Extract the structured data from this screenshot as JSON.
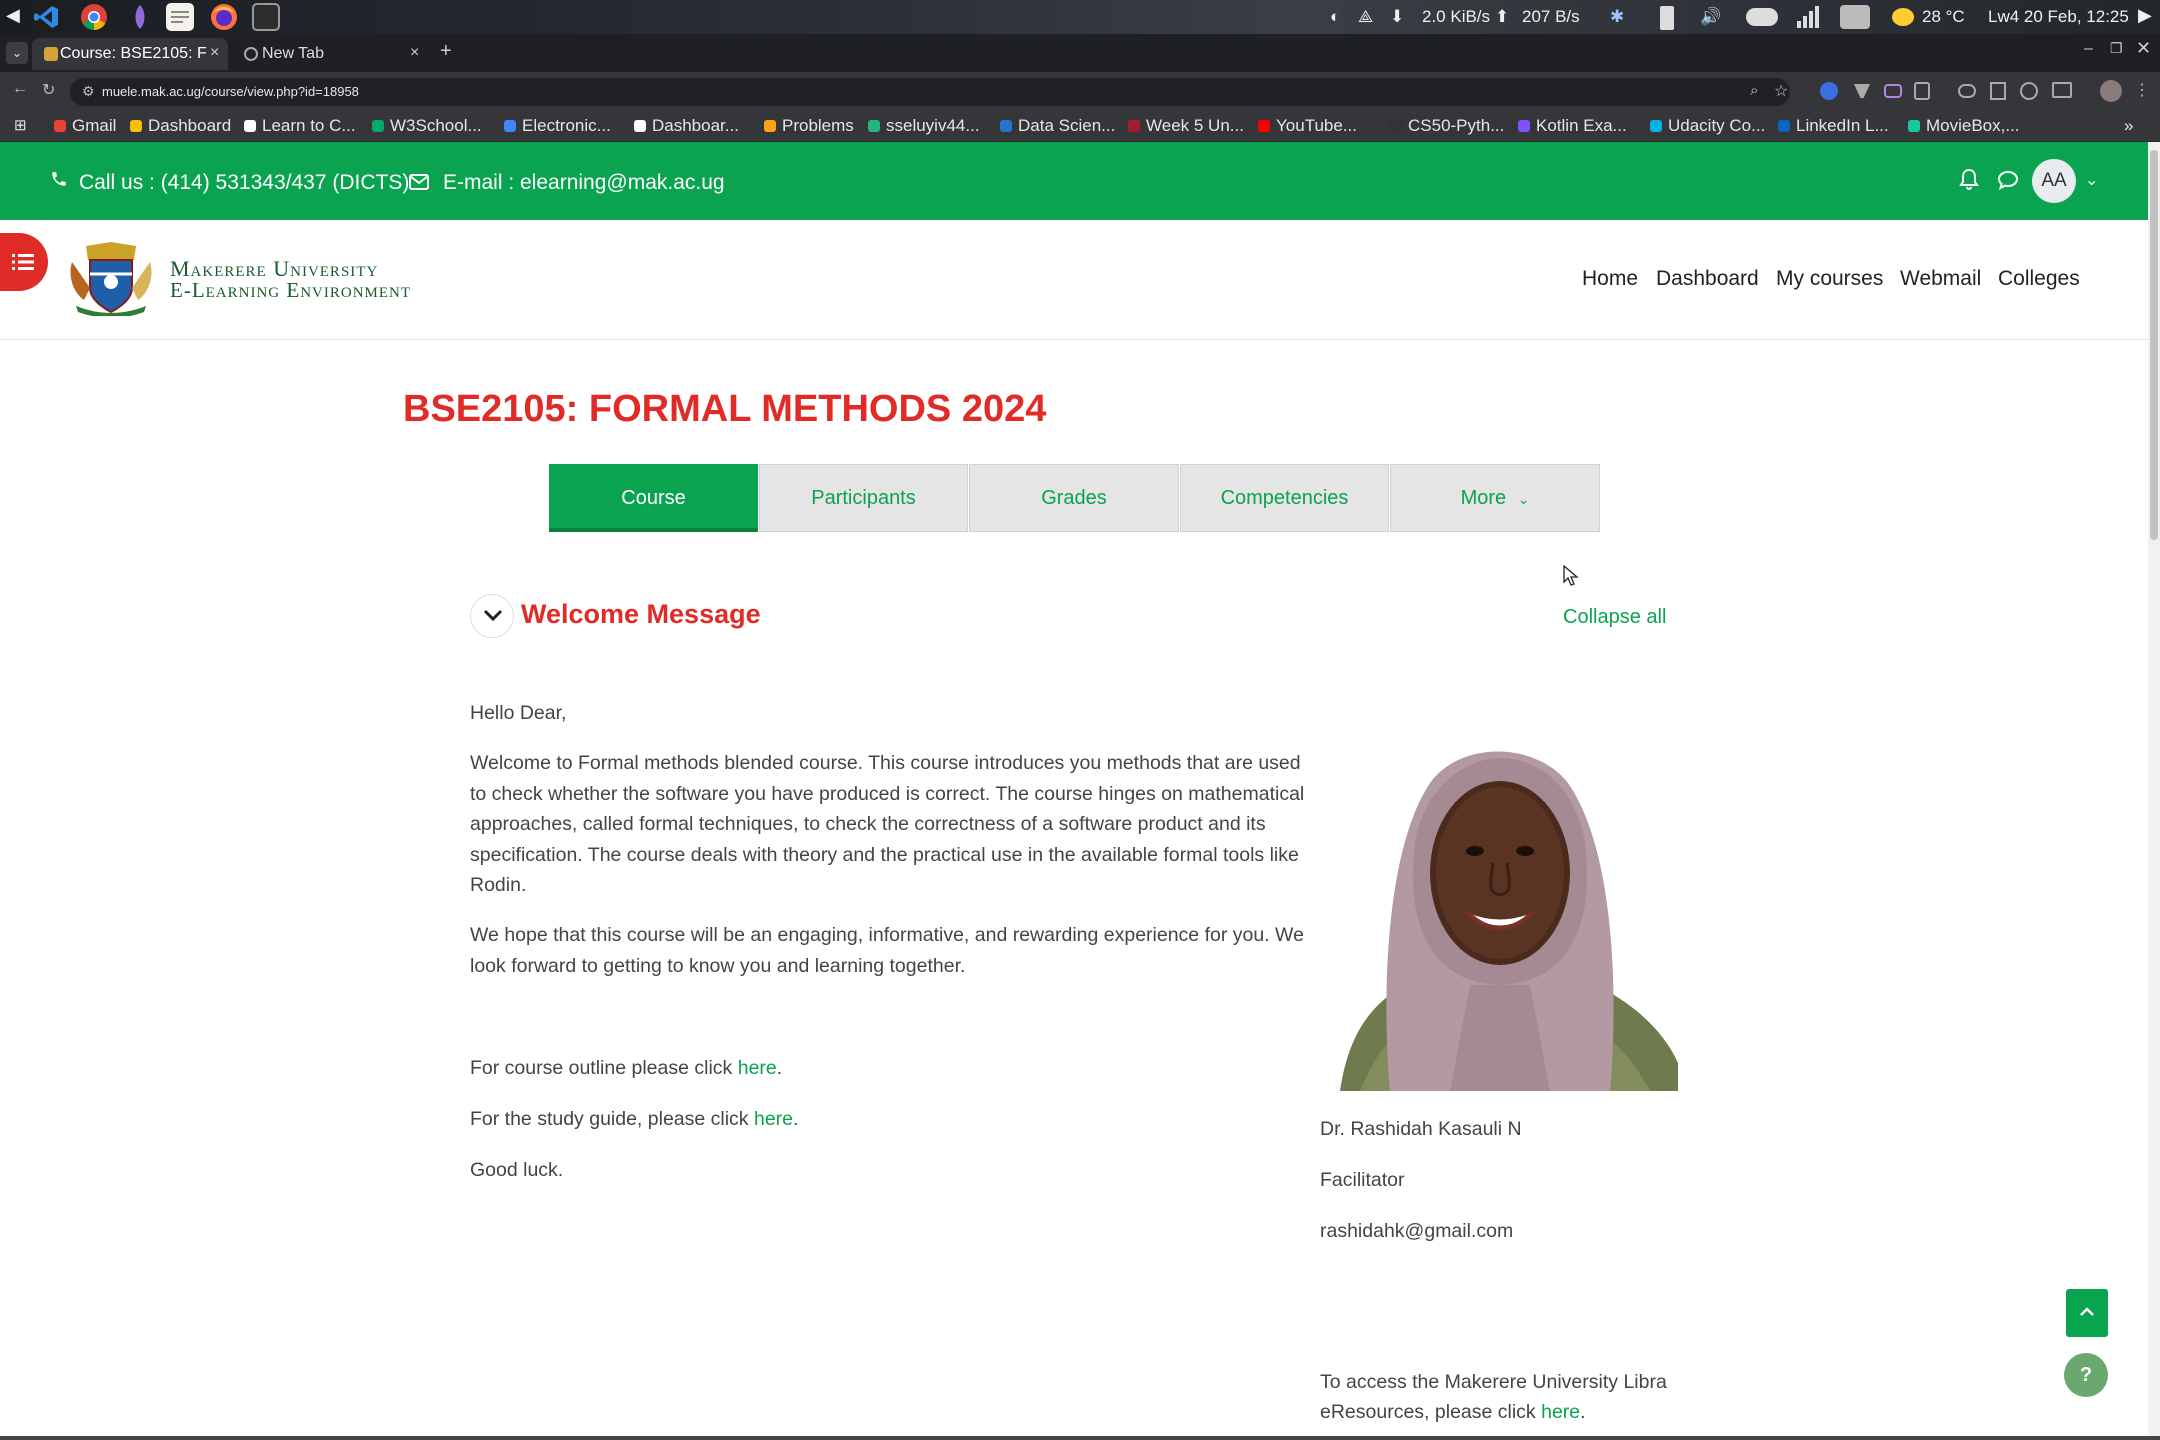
{
  "os": {
    "net_down": "2.0 KiB/s",
    "net_up": "207 B/s",
    "weather": "28 °C",
    "clock": "Lw4 20 Feb, 12:25"
  },
  "browser": {
    "tabs": [
      {
        "title": "Course: BSE2105: F",
        "close": "×"
      },
      {
        "title": "New Tab",
        "close": "×"
      }
    ],
    "new_tab": "+",
    "url": "muele.mak.ac.ug/course/view.php?id=18958",
    "bookmarks": [
      {
        "label": "Gmail",
        "color": "#ea4335"
      },
      {
        "label": "Dashboard",
        "color": "#fbbc04"
      },
      {
        "label": "Learn to C...",
        "color": "#ffffff"
      },
      {
        "label": "W3School...",
        "color": "#04aa6d"
      },
      {
        "label": "Electronic...",
        "color": "#4285f4"
      },
      {
        "label": "Dashboar...",
        "color": "#ffffff"
      },
      {
        "label": "Problems",
        "color": "#ffa116"
      },
      {
        "label": "sseluyiv44...",
        "color": "#24b47e"
      },
      {
        "label": "Data Scien...",
        "color": "#2a73cc"
      },
      {
        "label": "Week 5 Un...",
        "color": "#a51c30"
      },
      {
        "label": "YouTube...",
        "color": "#ff0000"
      },
      {
        "label": "CS50-Pyth...",
        "color": "#333333"
      },
      {
        "label": "Kotlin Exa...",
        "color": "#7f52ff"
      },
      {
        "label": "Udacity Co...",
        "color": "#02b3e4"
      },
      {
        "label": "LinkedIn L...",
        "color": "#0a66c2"
      },
      {
        "label": "MovieBox,...",
        "color": "#18c8a0"
      }
    ],
    "more": "»"
  },
  "site": {
    "phone": "Call us : (414) 531343/437 (DICTS)",
    "email": "E-mail : elearning@mak.ac.ug",
    "avatar_initials": "AA",
    "logo_line1": "Makerere University",
    "logo_line2": "E-Learning Environment",
    "nav": [
      "Home",
      "Dashboard",
      "My courses",
      "Webmail",
      "Colleges"
    ],
    "brand_green": "#0aa34f",
    "brand_red": "#e02b27"
  },
  "course": {
    "title": "BSE2105: FORMAL METHODS 2024",
    "tabs": [
      "Course",
      "Participants",
      "Grades",
      "Competencies",
      "More"
    ],
    "active_tab": "Course"
  },
  "section": {
    "title": "Welcome Message",
    "collapse_all": "Collapse all",
    "greeting": "Hello Dear,",
    "intro": "Welcome to Formal methods blended course. This course introduces you methods that are used to check whether the software you have produced is correct. The course hinges on mathematical approaches, called formal techniques, to check the correctness of a software product and its specification. The course deals with theory and the practical use in the available formal tools like Rodin.",
    "hope": "We hope that this course will be an engaging, informative, and rewarding experience for you. We look forward to getting to know you and learning together.",
    "outline_prefix": "For course outline please click ",
    "guide_prefix": "For the study guide, please click ",
    "link_text": "here",
    "period": ".",
    "closing": "Good luck.",
    "facilitator_name": "Dr. Rashidah Kasauli N",
    "facilitator_role": "Facilitator",
    "facilitator_email": "rashidahk@gmail.com",
    "library_line1": "To access the Makerere University Libra",
    "library_prefix": "eResources, please click "
  },
  "widgets": {
    "help": "?"
  }
}
